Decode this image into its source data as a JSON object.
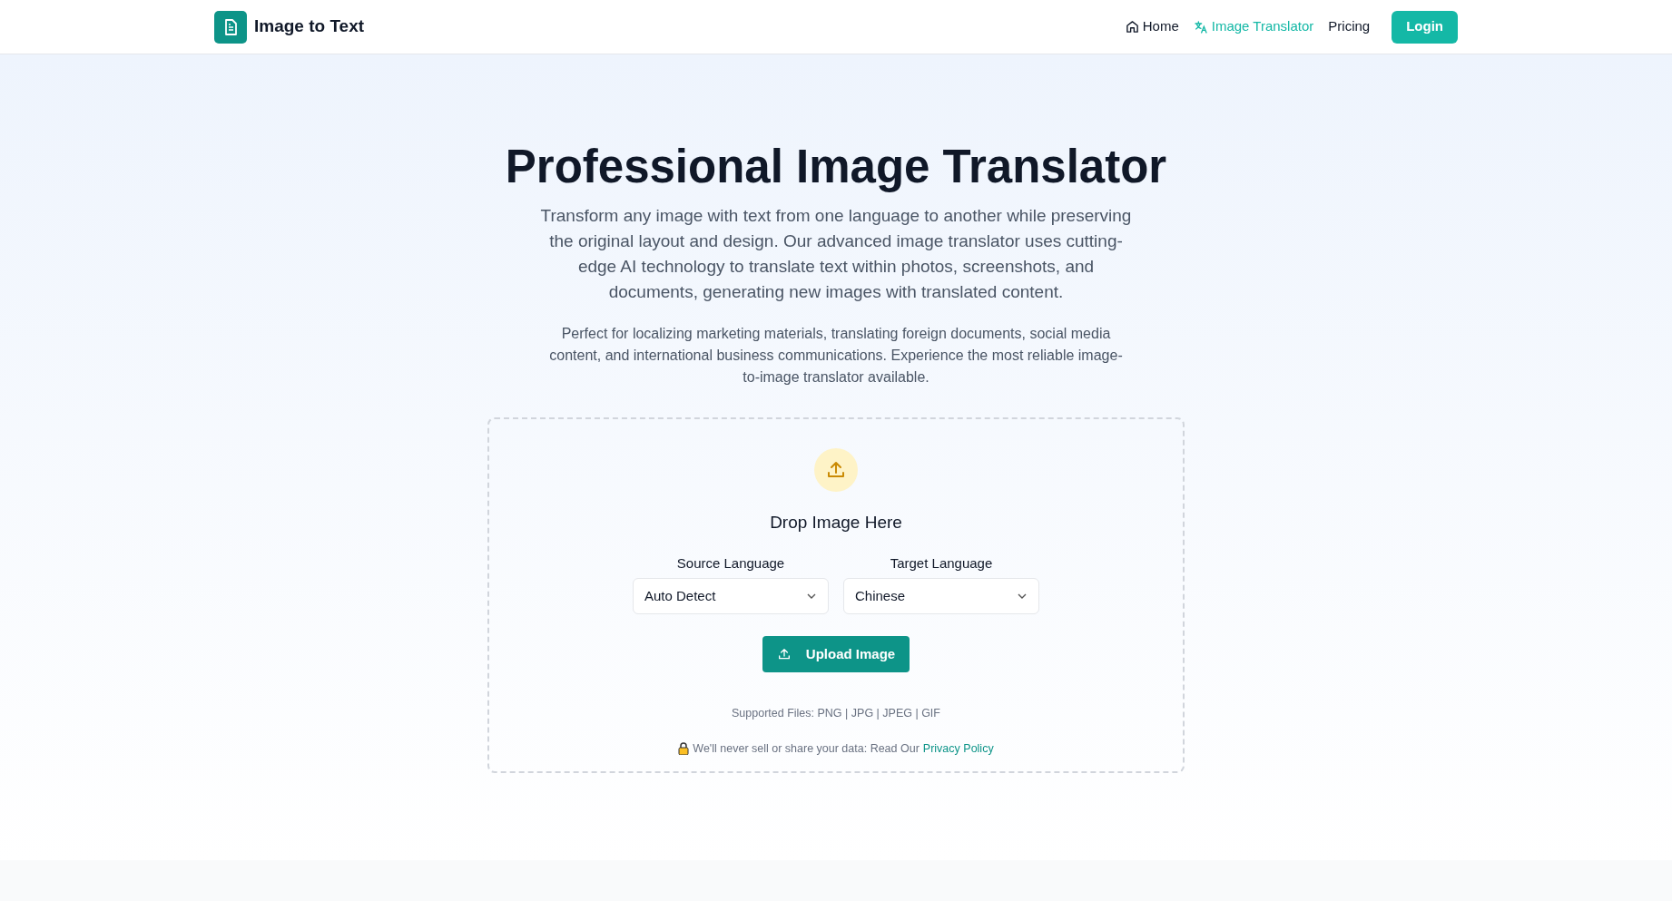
{
  "header": {
    "logo": "Image to Text",
    "nav": [
      {
        "label": "Home",
        "selected": false
      },
      {
        "label": "Image Translator",
        "selected": true
      },
      {
        "label": "Pricing",
        "selected": false
      }
    ],
    "login": "Login"
  },
  "hero": {
    "title": "Professional Image Translator",
    "lead": "Transform any image with text from one language to another while preserving the original layout and design. Our advanced image translator uses cutting-edge AI technology to translate text within photos, screenshots, and documents, generating new images with translated content.",
    "body": "Perfect for localizing marketing materials, translating foreign documents, social media content, and international business communications. Experience the most reliable image-to-image translator available."
  },
  "dropzone": {
    "title": "Drop Image Here",
    "selects": [
      {
        "label": "Source Language",
        "value": "Auto Detect"
      },
      {
        "label": "Target Language",
        "value": "Chinese"
      }
    ],
    "button": "Upload Image",
    "supported": "Supported Files: PNG | JPG | JPEG | GIF",
    "privacy": "We'll never sell or share your data: Read Our",
    "privacy_link": "Privacy Policy"
  }
}
